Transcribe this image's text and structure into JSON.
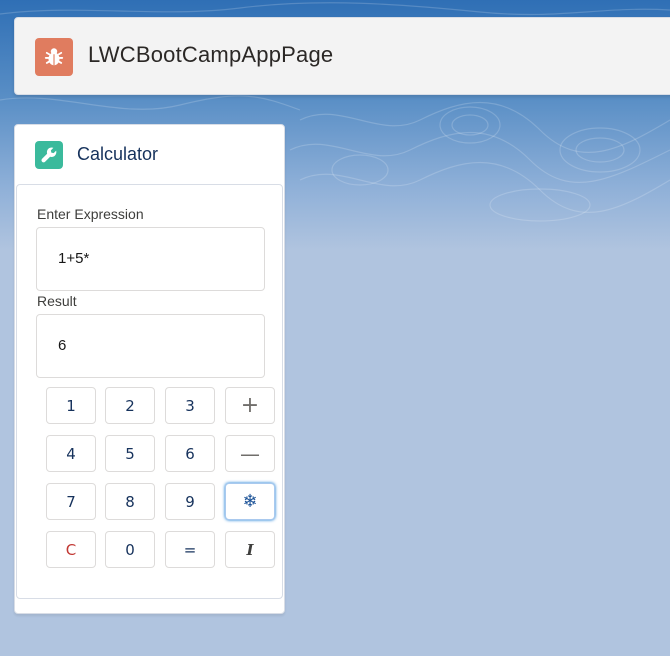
{
  "app": {
    "page_title": "LWCBootCampAppPage",
    "header_icon": "bug-icon",
    "header_icon_color": "#e07c5f"
  },
  "card": {
    "title": "Calculator",
    "icon": "wrench-icon",
    "icon_color": "#3bba9c"
  },
  "expression": {
    "label": "Enter Expression",
    "value": "1+5*"
  },
  "result": {
    "label": "Result",
    "value": "6"
  },
  "keypad": {
    "rows": [
      [
        "1",
        "2",
        "3",
        "+"
      ],
      [
        "4",
        "5",
        "6",
        "—"
      ],
      [
        "7",
        "8",
        "9",
        "❄"
      ],
      [
        "C",
        "0",
        "=",
        "I"
      ]
    ]
  },
  "colors": {
    "brand_blue": "#0070d2",
    "clear_red": "#c23934"
  }
}
